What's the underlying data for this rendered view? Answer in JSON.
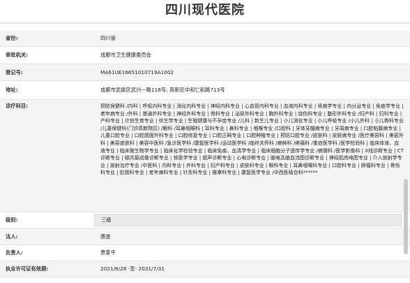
{
  "page_title": "四川现代医院",
  "rows": [
    {
      "label": "省份:",
      "value": "四川省"
    },
    {
      "label": "审批机关:",
      "value": "成都市卫生健康委员会"
    },
    {
      "label": "登记号:",
      "value": "MA61UE16651010719A1002"
    },
    {
      "label": "地址:",
      "value": "成都市武侯区武兴一路118号; 高新区中和仁和路713号"
    },
    {
      "label": "诊疗科目:",
      "value": "预防保健科 /内科 | 呼吸内科专业 | 消化内科专业 | 神经内科专业 | 心血管内科专业 | 血液内科专业 | 肾病学专业 | 内分泌专业 | 免疫学专业 | 老年病专业 /外科 | 普通外科专业 | 神经外科专业 | 骨科专业 | 泌尿外科专业 | 胸外科专业 | 烧伤科专业 | 整形外科专业 /妇产科 | 妇科专业 | 产科专业 | 计划生育专业 | 优生学专业 | 生殖健康与不孕症专业 /儿科 | 新生儿专业 | 小儿消化专业 | 小儿呼吸专业 /小儿外科 | 小儿骨科专业 /儿童保健科(门诊高新院区) /眼科 /耳鼻咽喉科 | 耳科专业 | 鼻科专业 | 咽喉专业 /口腔科 | 牙体牙髓病专业 | 牙周病专业 | 口腔粘膜病专业 | 儿童口腔专业 | 口腔颌面外科专业 | 口腔修复专业 | 口腔正畸专业 | 口腔种植专业 | 预防口腔专业 /皮肤科 | 皮肤病专业 /医疗美容科 | 美容外科 | 美容皮肤科 | 美容中医科 /急诊医学科 /康复医学科 /运动医学科 /临终关怀科 /麻醉科 /疼痛科 /重症医学科 /医学检验科 | 临床体液、血液专业 | 临床微生物学专业 | 临床化学检验专业 | 临床免疫、血清学专业 | 临床细胞分子遗传学专业 /病理科 /医学影像科 | X线诊断专业 | CT诊断专业 | 磁共振成像诊断专业 | 核医学专业 | 超声诊断专业 | 心电诊断专业 | 脑电及脑血流图诊断专业 | 神经肌肉电图专业 | 介入放射学专业 | 放射治疗专业 /中医科 | 内科专业 | 外科专业 | 妇产科专业 | 皮肤科专业 | 眼科专业 | 耳鼻咽喉科专业 | 口腔科专业 | 肿瘤科专业 | 骨伤科专业 | 肛肠科专业 | 老年病科专业 | 针灸科专业 | 推拿科专业 | 康复医学专业 /中西医结合科******"
    },
    {
      "label": "级别:",
      "value": "三级"
    },
    {
      "label": "法人:",
      "value": "唐逊"
    },
    {
      "label": "负责人:",
      "value": "景爱平"
    },
    {
      "label": "执业许可证有效期:",
      "value": "2021/6/28 -至- 2031/7/31"
    }
  ]
}
